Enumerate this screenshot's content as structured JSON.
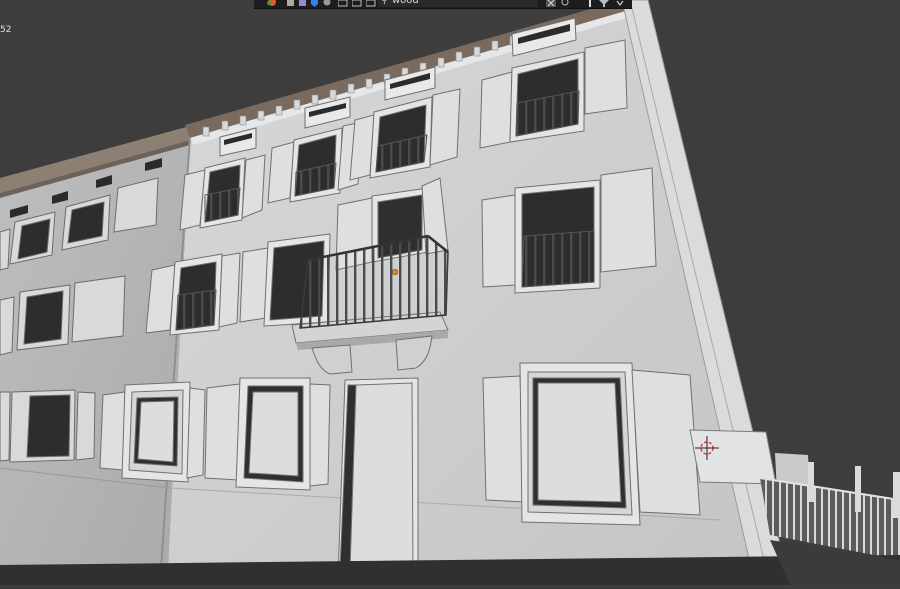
{
  "header": {
    "search_value": "wood",
    "search_icon": "search-icon",
    "editor_icons": [
      "color-palette-icon",
      "mesh-icon",
      "material-icon",
      "shield-icon",
      "layers-icon",
      "folder-icon",
      "image-icon",
      "brush-icon"
    ],
    "right_icons": [
      "close-icon",
      "settings-icon",
      "pin-icon",
      "filter-icon",
      "chevron-down-icon"
    ]
  },
  "viewport": {
    "frame_label": "52",
    "object_origin_color": "#e08a1e",
    "background_color": "#3d3d3d",
    "model_color": "#c9cacc"
  }
}
